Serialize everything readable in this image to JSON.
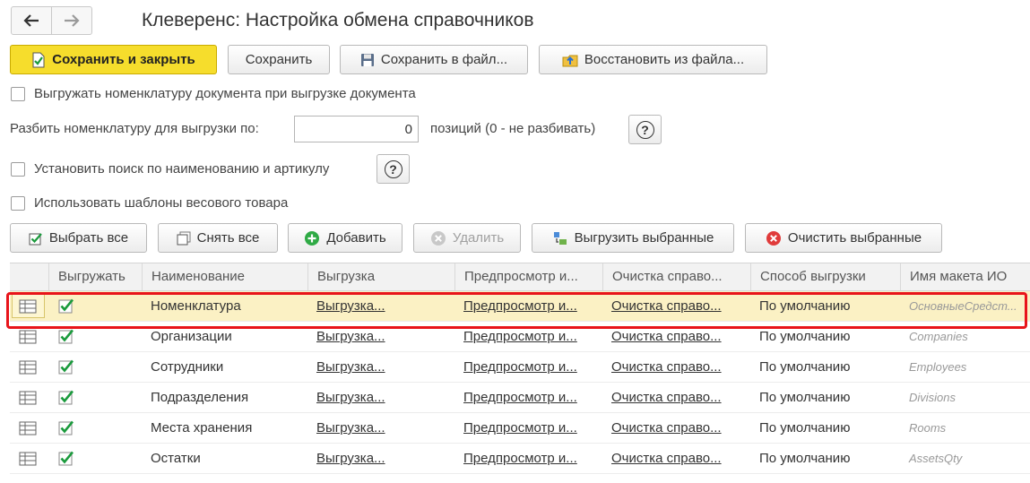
{
  "window": {
    "title": "Клеверенс: Настройка обмена справочников"
  },
  "toolbar": {
    "save_close": "Сохранить и закрыть",
    "save": "Сохранить",
    "save_file": "Сохранить в файл...",
    "restore_file": "Восстановить из файла..."
  },
  "options": {
    "export_nomenclature": "Выгружать номенклатуру документа при выгрузке документа",
    "split_label": "Разбить номенклатуру для выгрузки по:",
    "split_value": "0",
    "split_suffix": "позиций (0 - не разбивать)",
    "search_by_name": "Установить поиск по наименованию и артикулу",
    "weight_templates": "Использовать шаблоны весового товара"
  },
  "list_toolbar": {
    "select_all": "Выбрать все",
    "unselect_all": "Снять все",
    "add": "Добавить",
    "delete": "Удалить",
    "export_selected": "Выгрузить выбранные",
    "clear_selected": "Очистить выбранные"
  },
  "table": {
    "columns": [
      "",
      "Выгружать",
      "Наименование",
      "Выгрузка",
      "Предпросмотр и...",
      "Очистка справо...",
      "Способ выгрузки",
      "Имя макета ИО"
    ],
    "rows": [
      {
        "checked": true,
        "name": "Номенклатура",
        "export": "Выгрузка...",
        "preview": "Предпросмотр и...",
        "clear": "Очистка справо...",
        "method": "По умолчанию",
        "layout": "ОсновныеСредст...",
        "selected": true
      },
      {
        "checked": true,
        "name": "Организации",
        "export": "Выгрузка...",
        "preview": "Предпросмотр и...",
        "clear": "Очистка справо...",
        "method": "По умолчанию",
        "layout": "Companies",
        "selected": false
      },
      {
        "checked": true,
        "name": "Сотрудники",
        "export": "Выгрузка...",
        "preview": "Предпросмотр и...",
        "clear": "Очистка справо...",
        "method": "По умолчанию",
        "layout": "Employees",
        "selected": false
      },
      {
        "checked": true,
        "name": "Подразделения",
        "export": "Выгрузка...",
        "preview": "Предпросмотр и...",
        "clear": "Очистка справо...",
        "method": "По умолчанию",
        "layout": "Divisions",
        "selected": false
      },
      {
        "checked": true,
        "name": "Места хранения",
        "export": "Выгрузка...",
        "preview": "Предпросмотр и...",
        "clear": "Очистка справо...",
        "method": "По умолчанию",
        "layout": "Rooms",
        "selected": false
      },
      {
        "checked": true,
        "name": "Остатки",
        "export": "Выгрузка...",
        "preview": "Предпросмотр и...",
        "clear": "Очистка справо...",
        "method": "По умолчанию",
        "layout": "AssetsQty",
        "selected": false
      }
    ]
  },
  "colors": {
    "accent_yellow": "#f6dd2c",
    "selected_row": "#fbf1c4",
    "highlight_frame": "#e8141a",
    "check_green": "#1a9a3c"
  },
  "icons": {
    "back": "arrow-left-icon",
    "forward": "arrow-right-icon",
    "row": "table-grid-icon",
    "help": "question-circle-icon"
  }
}
